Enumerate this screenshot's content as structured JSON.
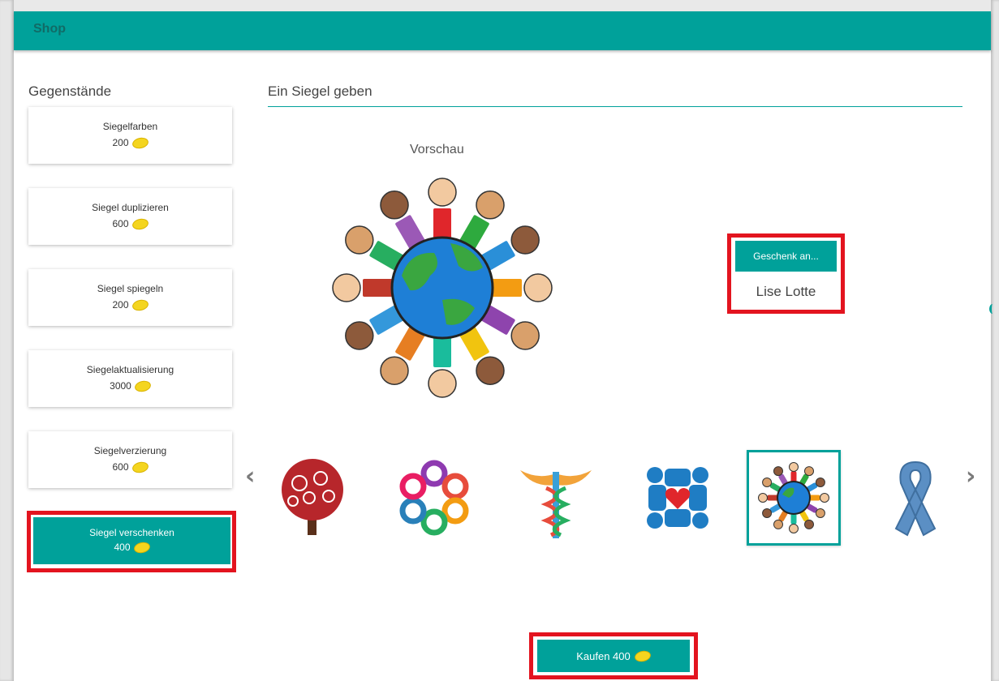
{
  "header": {
    "title": "Shop"
  },
  "sidebar": {
    "title": "Gegenstände",
    "items": [
      {
        "name": "Siegelfarben",
        "price": "200"
      },
      {
        "name": "Siegel duplizieren",
        "price": "600"
      },
      {
        "name": "Siegel spiegeln",
        "price": "200"
      },
      {
        "name": "Siegelaktualisierung",
        "price": "3000"
      },
      {
        "name": "Siegelverzierung",
        "price": "600"
      },
      {
        "name": "Siegel verschenken",
        "price": "400",
        "active": true
      }
    ]
  },
  "main": {
    "title": "Ein Siegel geben",
    "preview_label": "Vorschau",
    "gift_button": "Geschenk an...",
    "recipient": "Lise Lotte",
    "buy_button": "Kaufen 400",
    "thumbnails": [
      {
        "icon": "tree-seal-icon"
      },
      {
        "icon": "ribbons-circle-seal-icon"
      },
      {
        "icon": "caduceus-puzzle-seal-icon"
      },
      {
        "icon": "people-heart-seal-icon"
      },
      {
        "icon": "children-globe-seal-icon",
        "selected": true
      },
      {
        "icon": "blue-ribbon-seal-icon"
      }
    ]
  },
  "colors": {
    "accent": "#00a19a",
    "highlight": "#e3141f",
    "coin": "#f4d51f"
  }
}
